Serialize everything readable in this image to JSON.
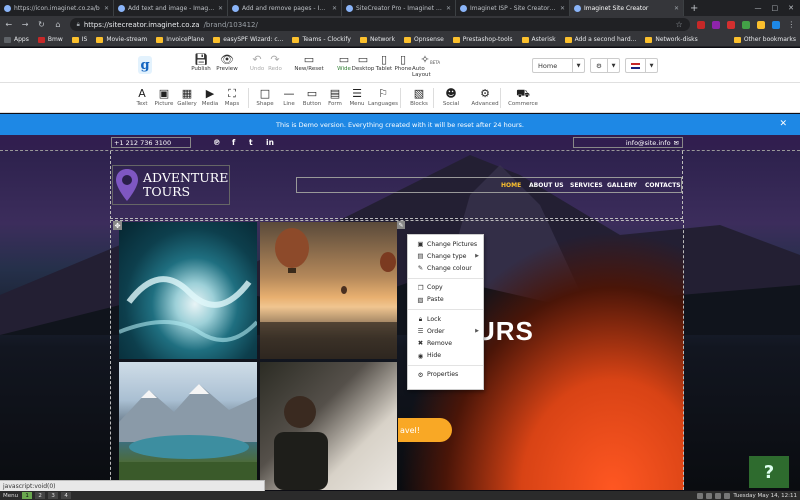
{
  "browser": {
    "tabs": [
      {
        "label": "https://icon.imaginet.co.za/b",
        "active": false
      },
      {
        "label": "Add text and image - Imaginet",
        "active": false
      },
      {
        "label": "Add and remove pages - Imagi",
        "active": false
      },
      {
        "label": "SiteCreator Pro - Imaginet FAQ",
        "active": false
      },
      {
        "label": "Imaginet ISP - Site Creator Ho",
        "active": false
      },
      {
        "label": "Imaginet Site Creator",
        "active": true
      }
    ],
    "url_host": "https://sitecreator.imaginet.co.za",
    "url_path": "/brand/103412/",
    "bookmarks": [
      "Apps",
      "Bmw",
      "IS",
      "Movie-stream",
      "InvoicePlane",
      "easySPF Wizard: c...",
      "Teams - Clockify",
      "Network",
      "Opnsense",
      "Prestashop-tools",
      "Asterisk",
      "Add a second hard...",
      "Network-disks"
    ],
    "other_bookmarks": "Other bookmarks"
  },
  "app_toolbar": {
    "buttons": [
      {
        "label": "Publish",
        "icon": "save-icon",
        "state": "normal"
      },
      {
        "label": "Preview",
        "icon": "eye-icon",
        "state": "normal"
      },
      {
        "label": "Undo",
        "icon": "undo-icon",
        "state": "disabled"
      },
      {
        "label": "Redo",
        "icon": "redo-icon",
        "state": "disabled"
      },
      {
        "label": "New/Reset",
        "icon": "file-icon",
        "state": "normal"
      },
      {
        "label": "Wide",
        "icon": "monitor-icon",
        "state": "active"
      },
      {
        "label": "Desktop",
        "icon": "desktop-icon",
        "state": "normal"
      },
      {
        "label": "Tablet",
        "icon": "tablet-icon",
        "state": "normal"
      },
      {
        "label": "Phone",
        "icon": "phone-icon",
        "state": "normal"
      },
      {
        "label": "Auto Layout",
        "icon": "magic-icon",
        "state": "normal"
      }
    ],
    "beta": "BETA",
    "page_select": "Home"
  },
  "widgets": [
    {
      "label": "Text",
      "glyph": "A"
    },
    {
      "label": "Picture",
      "glyph": "▣"
    },
    {
      "label": "Gallery",
      "glyph": "▦"
    },
    {
      "label": "Media",
      "glyph": "▶"
    },
    {
      "label": "Maps",
      "glyph": "⛶"
    },
    {
      "label": "Shape",
      "glyph": "□"
    },
    {
      "label": "Line",
      "glyph": "—"
    },
    {
      "label": "Button",
      "glyph": "▭"
    },
    {
      "label": "Form",
      "glyph": "▤"
    },
    {
      "label": "Menu",
      "glyph": "☰"
    },
    {
      "label": "Languages",
      "glyph": "⚐"
    },
    {
      "label": "Blocks",
      "glyph": "▧"
    },
    {
      "label": "Social",
      "glyph": "☻"
    },
    {
      "label": "Advanced",
      "glyph": "⚙"
    },
    {
      "label": "Commerce",
      "glyph": "⛟"
    }
  ],
  "banner": {
    "text": "This is Demo version. Everything created with it will be reset after 24 hours.",
    "close": "✕"
  },
  "site": {
    "phone": "+1 212 736 3100",
    "email": "info@site.info",
    "logo_line1": "ADVENTURE",
    "logo_line2": "TOURS",
    "menu": [
      {
        "label": "HOME",
        "active": true
      },
      {
        "label": "ABOUT US",
        "active": false
      },
      {
        "label": "SERVICES",
        "active": false
      },
      {
        "label": "GALLERY",
        "active": false
      },
      {
        "label": "CONTACTS",
        "active": false
      }
    ],
    "hero_text": "URS",
    "hero_button": "avel!"
  },
  "context_menu": {
    "groups": [
      [
        {
          "label": "Change Pictures",
          "icon": "pictures-icon",
          "sub": false
        },
        {
          "label": "Change type",
          "icon": "type-icon",
          "sub": true
        },
        {
          "label": "Change colour",
          "icon": "colour-icon",
          "sub": false
        }
      ],
      [
        {
          "label": "Copy",
          "icon": "copy-icon",
          "sub": false
        },
        {
          "label": "Paste",
          "icon": "paste-icon",
          "sub": false
        }
      ],
      [
        {
          "label": "Lock",
          "icon": "lock-icon",
          "sub": false
        },
        {
          "label": "Order",
          "icon": "order-icon",
          "sub": true
        },
        {
          "label": "Remove",
          "icon": "remove-icon",
          "sub": false
        },
        {
          "label": "Hide",
          "icon": "hide-icon",
          "sub": false
        }
      ],
      [
        {
          "label": "Properties",
          "icon": "properties-icon",
          "sub": false
        }
      ]
    ]
  },
  "help": "?",
  "status_url": "javascript:void(0)",
  "taskbar": {
    "menu": "Menu",
    "workspaces": [
      "1",
      "2",
      "3",
      "4"
    ],
    "active_workspace": "1",
    "clock": "Tuesday May 14, 12:11"
  },
  "colors": {
    "banner": "#1e88e5",
    "menu_active": "#fbc02d",
    "help_bg": "#2e6b2e"
  }
}
